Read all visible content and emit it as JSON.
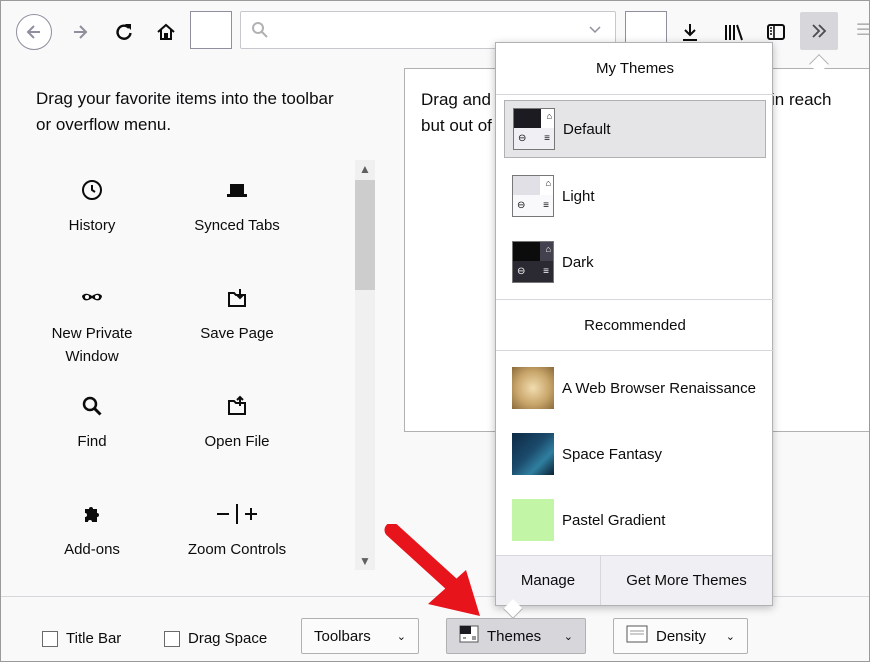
{
  "toolbar": {
    "icons": [
      "back-arrow-icon",
      "forward-arrow-icon",
      "reload-icon",
      "home-icon",
      "search-icon",
      "chevron-down-icon",
      "download-icon",
      "library-icon",
      "sidebar-icon",
      "overflow-chevrons-icon"
    ]
  },
  "palette": {
    "instructions": "Drag your favorite items into the toolbar or overflow menu.",
    "items": [
      {
        "label": "History",
        "icon": "clock-icon"
      },
      {
        "label": "Synced Tabs",
        "icon": "synced-tabs-icon"
      },
      {
        "label": "New Private Window",
        "icon": "private-mask-icon"
      },
      {
        "label": "Save Page",
        "icon": "save-page-icon"
      },
      {
        "label": "Find",
        "icon": "magnifier-icon"
      },
      {
        "label": "Open File",
        "icon": "open-file-icon"
      },
      {
        "label": "Add-ons",
        "icon": "puzzle-icon"
      },
      {
        "label": "Zoom Controls",
        "icon": "zoom-icon"
      }
    ]
  },
  "overflow_panel": {
    "text_left": "Drag and\nbut out of",
    "text_right": "in reach"
  },
  "themes_popup": {
    "my_themes_title": "My Themes",
    "my_themes": [
      {
        "label": "Default",
        "selected": true
      },
      {
        "label": "Light",
        "selected": false
      },
      {
        "label": "Dark",
        "selected": false
      }
    ],
    "recommended_title": "Recommended",
    "recommended": [
      {
        "label": "A Web Browser Renaissance",
        "color": "#c9a66b"
      },
      {
        "label": "Space Fantasy",
        "color": "#1b4a6b"
      },
      {
        "label": "Pastel Gradient",
        "color": "#c2f5a6"
      }
    ],
    "manage_label": "Manage",
    "get_more_label": "Get More Themes"
  },
  "bottombar": {
    "title_bar_label": "Title Bar",
    "drag_space_label": "Drag Space",
    "toolbars_label": "Toolbars",
    "themes_label": "Themes",
    "density_label": "Density"
  },
  "colors": {
    "selected_row": "#e5e5e7",
    "arrow_red": "#e8141b",
    "overflow_button": "#d7d7db"
  }
}
